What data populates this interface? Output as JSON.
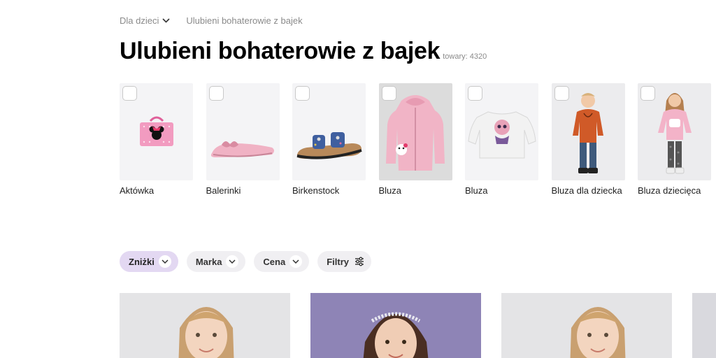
{
  "breadcrumb": {
    "first": "Dla dzieci",
    "current": "Ulubieni bohaterowie z bajek"
  },
  "page": {
    "title": "Ulubieni bohaterowie z bajek",
    "count": "towary: 4320"
  },
  "categories": [
    {
      "label": "Aktówka",
      "icon": "minnie-briefcase"
    },
    {
      "label": "Balerinki",
      "icon": "pink-ballet-flat"
    },
    {
      "label": "Birkenstock",
      "icon": "sandal"
    },
    {
      "label": "Bluza",
      "icon": "pink-hoodie"
    },
    {
      "label": "Bluza",
      "icon": "white-sweatshirt"
    },
    {
      "label": "Bluza dla dziecka",
      "icon": "boy-orange-hoodie"
    },
    {
      "label": "Bluza dziecięca",
      "icon": "girl-pink-sweatshirt"
    }
  ],
  "filters": {
    "discounts": "Zniżki",
    "brand": "Marka",
    "price": "Cena",
    "more": "Filtry"
  },
  "colors": {
    "active_chip": "#e3d8f2",
    "chip": "#f0eff2"
  }
}
